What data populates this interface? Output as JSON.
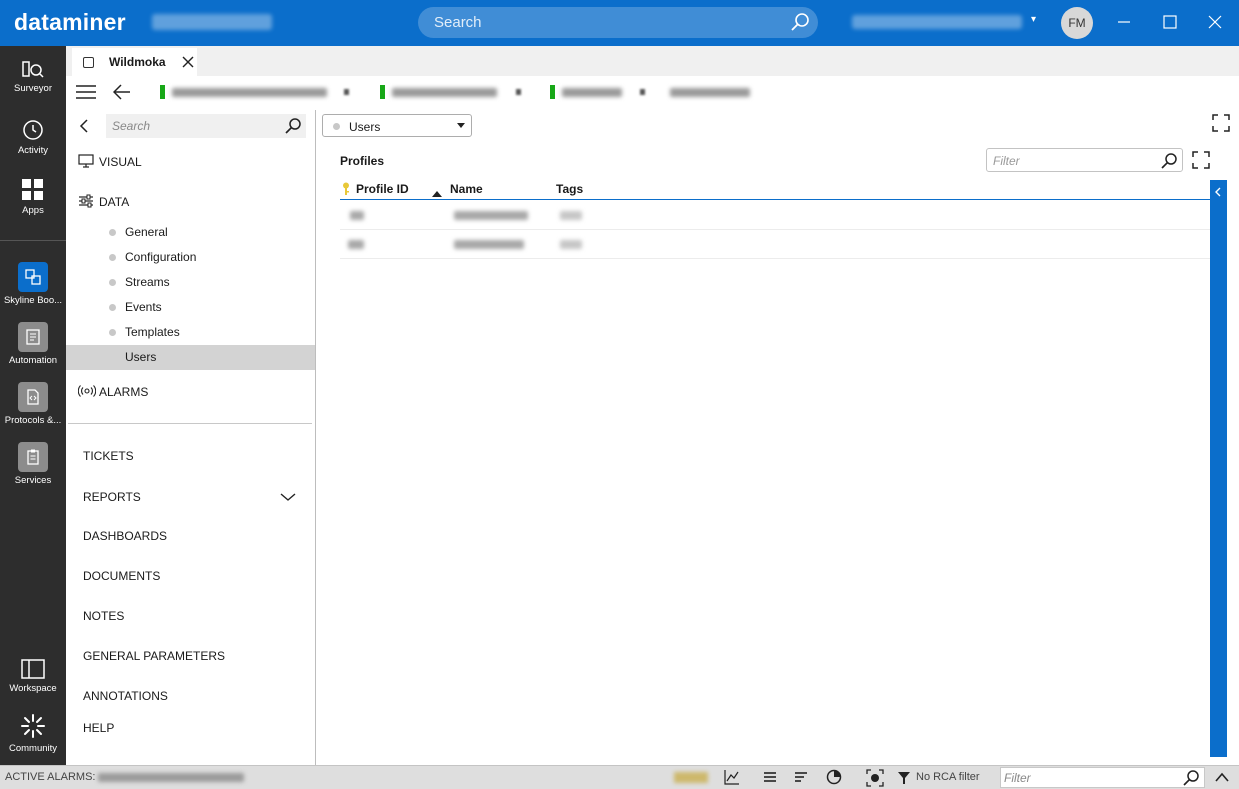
{
  "app": {
    "brand": "dataminer",
    "search_placeholder": "Search",
    "user_initials": "FM"
  },
  "rail": {
    "items": [
      {
        "label": "Surveyor",
        "icon": "surveyor-icon"
      },
      {
        "label": "Activity",
        "icon": "activity-icon"
      },
      {
        "label": "Apps",
        "icon": "apps-icon"
      },
      {
        "label": "Skyline Boo...",
        "icon": "skyline-booking-icon"
      },
      {
        "label": "Automation",
        "icon": "automation-icon"
      },
      {
        "label": "Protocols &...",
        "icon": "protocols-icon"
      },
      {
        "label": "Services",
        "icon": "services-icon"
      },
      {
        "label": "Workspace",
        "icon": "workspace-icon"
      },
      {
        "label": "Community",
        "icon": "community-icon"
      }
    ]
  },
  "tab": {
    "title": "Wildmoka"
  },
  "tree": {
    "search_placeholder": "Search",
    "visual": "VISUAL",
    "data": "DATA",
    "data_items": [
      "General",
      "Configuration",
      "Streams",
      "Events",
      "Templates",
      "Users"
    ],
    "selected_item": "Users",
    "alarms": "ALARMS",
    "menu": [
      "TICKETS",
      "REPORTS",
      "DASHBOARDS",
      "DOCUMENTS",
      "NOTES",
      "GENERAL PARAMETERS",
      "ANNOTATIONS",
      "HELP"
    ]
  },
  "main": {
    "dropdown_value": "Users",
    "section_title": "Profiles",
    "filter_placeholder": "Filter",
    "columns": [
      "Profile ID",
      "Name",
      "Tags"
    ],
    "sort_column": "Name"
  },
  "status": {
    "active_alarms_label": "ACTIVE ALARMS:",
    "rca_label": "No RCA filter",
    "filter_placeholder": "Filter"
  },
  "colors": {
    "brand_blue": "#0b6ecb",
    "rail_bg": "#2d2d2d",
    "status_green": "#18a818"
  }
}
